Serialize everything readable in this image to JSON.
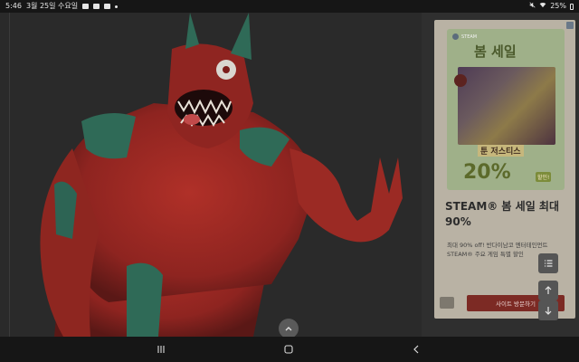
{
  "status_bar": {
    "time": "5:46",
    "date": "3월 25일 수요일",
    "battery": "25%"
  },
  "viewer": {
    "collapse_icon": "chevron-up-icon"
  },
  "ad": {
    "brand": "STEAM",
    "banner_title": "봄 세일",
    "banner_subtitle": "툰 저스티스",
    "banner_discount": "20%",
    "banner_discount_tag": "할인!",
    "headline": "STEAM® 봄 세일 최대 90%",
    "description": "최대 90% off! 반다이남코 엔터테인먼트 STEAM® 주요 게임 특별 할인",
    "cta_label": "사이트 방문하기"
  },
  "side_buttons": {
    "list_icon": "list-icon",
    "up_icon": "arrow-up-icon",
    "down_icon": "arrow-down-icon"
  },
  "nav": {
    "recents_icon": "recents-icon",
    "home_icon": "home-icon",
    "back_icon": "back-icon"
  }
}
